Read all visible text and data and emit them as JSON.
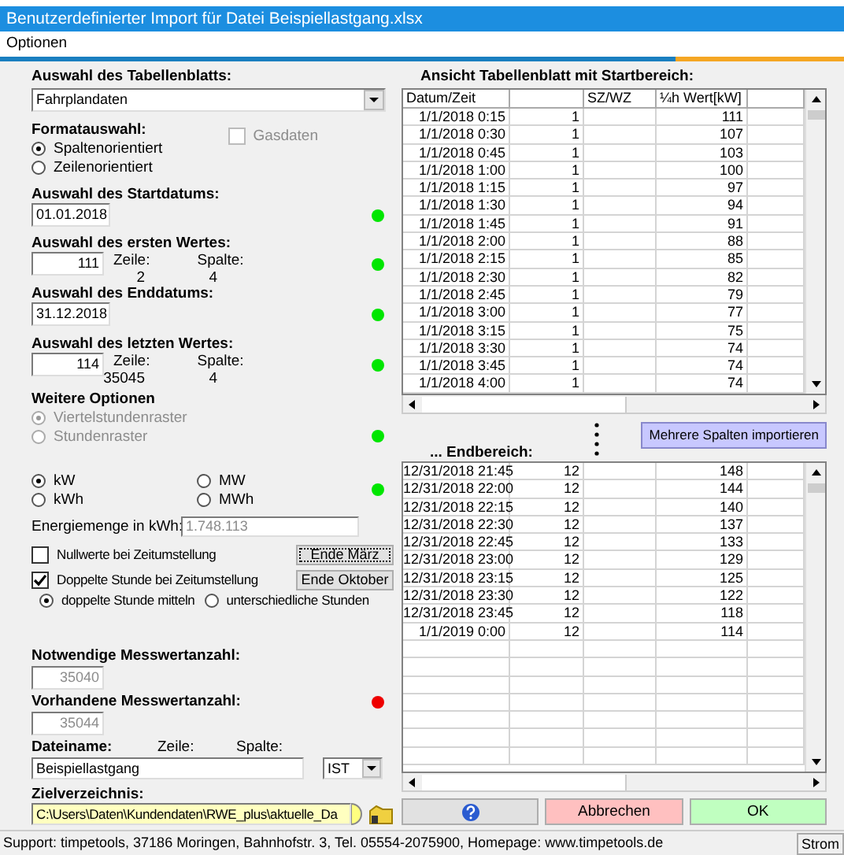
{
  "window": {
    "title": "Benutzerdefinierter Import für Datei Beispiellastgang.xlsx"
  },
  "menu": [
    "Optionen"
  ],
  "sheet": {
    "label": "Auswahl des Tabellenblatts:",
    "value": "Fahrplandaten"
  },
  "format": {
    "label": "Formatauswahl:",
    "options": [
      {
        "label": "Spaltenorientiert",
        "selected": true
      },
      {
        "label": "Zeilenorientiert",
        "selected": false
      }
    ],
    "gas": {
      "label": "Gasdaten",
      "checked": false,
      "disabled": true
    }
  },
  "start_date": {
    "label": "Auswahl des Startdatums:",
    "value": "01.01.2018",
    "indicator": {
      "color": "#00e600"
    }
  },
  "first_value": {
    "label": "Auswahl des ersten Wertes:",
    "value": "111",
    "row_label": "Zeile:",
    "col_label": "Spalte:",
    "row": "2",
    "col": "4",
    "indicator": {
      "color": "#00e600"
    }
  },
  "end_date": {
    "label": "Auswahl des Enddatums:",
    "value": "31.12.2018",
    "indicator": {
      "color": "#00e600"
    }
  },
  "last_value": {
    "label": "Auswahl des letzten Wertes:",
    "value": "114",
    "row_label": "Zeile:",
    "col_label": "Spalte:",
    "row": "35045",
    "col": "4",
    "indicator": {
      "color": "#00e600"
    }
  },
  "further": {
    "label": "Weitere Optionen",
    "options": [
      {
        "label": "Viertelstundenraster",
        "selected": true,
        "disabled": true
      },
      {
        "label": "Stundenraster",
        "selected": false,
        "disabled": true
      }
    ],
    "indicator": {
      "color": "#00e600"
    }
  },
  "units": {
    "options": [
      {
        "label": "kW",
        "selected": true
      },
      {
        "label": "MW",
        "selected": false
      },
      {
        "label": "kWh",
        "selected": false
      },
      {
        "label": "MWh",
        "selected": false
      }
    ],
    "indicator": {
      "color": "#00e600"
    }
  },
  "energy": {
    "label": "Energiemenge in kWh:",
    "value": "1.748.113",
    "disabled": true
  },
  "dst": [
    {
      "label": "Nullwerte bei Zeitumstellung",
      "checked": false,
      "button": "Ende März",
      "focused": true
    },
    {
      "label": "Doppelte Stunde bei Zeitumstellung",
      "checked": true,
      "button": "Ende Oktober",
      "focused": false
    }
  ],
  "double_hour": [
    {
      "label": "doppelte Stunde mitteln",
      "selected": true
    },
    {
      "label": "unterschiedliche Stunden",
      "selected": false
    }
  ],
  "required": {
    "label": "Notwendige Messwertanzahl:",
    "value": "35040",
    "disabled": true
  },
  "present": {
    "label": "Vorhandene Messwertanzahl:",
    "value": "35044",
    "disabled": true,
    "indicator": {
      "color": "#ee0000"
    }
  },
  "file": {
    "label": "Dateiname:",
    "row_label": "Zeile:",
    "col_label": "Spalte:",
    "value": "Beispiellastgang",
    "type": "IST"
  },
  "target": {
    "label": "Zielverzeichnis:",
    "value": "C:\\Users\\Daten\\Kundendaten\\RWE_plus\\aktuelle_Da"
  },
  "preview": {
    "title": "Ansicht Tabellenblatt mit Startbereich:",
    "columns": {
      "datum_zeit": "Datum/Zeit",
      "sz_wz": "SZ/WZ",
      "wert": "¼h Wert[kW]"
    },
    "rows": [
      {
        "datum_zeit": "1/1/2018 0:15",
        "column_2": "1",
        "wert": "111"
      },
      {
        "datum_zeit": "1/1/2018 0:30",
        "column_2": "1",
        "wert": "107"
      },
      {
        "datum_zeit": "1/1/2018 0:45",
        "column_2": "1",
        "wert": "103"
      },
      {
        "datum_zeit": "1/1/2018 1:00",
        "column_2": "1",
        "wert": "100"
      },
      {
        "datum_zeit": "1/1/2018 1:15",
        "column_2": "1",
        "wert": "97"
      },
      {
        "datum_zeit": "1/1/2018 1:30",
        "column_2": "1",
        "wert": "94"
      },
      {
        "datum_zeit": "1/1/2018 1:45",
        "column_2": "1",
        "wert": "91"
      },
      {
        "datum_zeit": "1/1/2018 2:00",
        "column_2": "1",
        "wert": "88"
      },
      {
        "datum_zeit": "1/1/2018 2:15",
        "column_2": "1",
        "wert": "85"
      },
      {
        "datum_zeit": "1/1/2018 2:30",
        "column_2": "1",
        "wert": "82"
      },
      {
        "datum_zeit": "1/1/2018 2:45",
        "column_2": "1",
        "wert": "79"
      },
      {
        "datum_zeit": "1/1/2018 3:00",
        "column_2": "1",
        "wert": "77"
      },
      {
        "datum_zeit": "1/1/2018 3:15",
        "column_2": "1",
        "wert": "75"
      },
      {
        "datum_zeit": "1/1/2018 3:30",
        "column_2": "1",
        "wert": "74"
      },
      {
        "datum_zeit": "1/1/2018 3:45",
        "column_2": "1",
        "wert": "74"
      },
      {
        "datum_zeit": "1/1/2018 4:00",
        "column_2": "1",
        "wert": "74"
      }
    ]
  },
  "more_button": "Mehrere Spalten importieren",
  "end_preview": {
    "title": "... Endbereich:",
    "rows": [
      {
        "datum_zeit": "12/31/2018 21:45",
        "column_2": "12",
        "wert": "148"
      },
      {
        "datum_zeit": "12/31/2018 22:00",
        "column_2": "12",
        "wert": "144"
      },
      {
        "datum_zeit": "12/31/2018 22:15",
        "column_2": "12",
        "wert": "140"
      },
      {
        "datum_zeit": "12/31/2018 22:30",
        "column_2": "12",
        "wert": "137"
      },
      {
        "datum_zeit": "12/31/2018 22:45",
        "column_2": "12",
        "wert": "133"
      },
      {
        "datum_zeit": "12/31/2018 23:00",
        "column_2": "12",
        "wert": "129"
      },
      {
        "datum_zeit": "12/31/2018 23:15",
        "column_2": "12",
        "wert": "125"
      },
      {
        "datum_zeit": "12/31/2018 23:30",
        "column_2": "12",
        "wert": "122"
      },
      {
        "datum_zeit": "12/31/2018 23:45",
        "column_2": "12",
        "wert": "118"
      },
      {
        "datum_zeit": "1/1/2019 0:00",
        "column_2": "12",
        "wert": "114"
      }
    ]
  },
  "buttons": [
    {
      "kind": "help"
    },
    {
      "kind": "cancel",
      "label": "Abbrechen"
    },
    {
      "kind": "ok",
      "label": "OK"
    }
  ],
  "status_bar": {
    "text": "Support: timpetools, 37186 Moringen, Bahnhofstr. 3, Tel. 05554-2075900, Homepage: www.timpetools.de",
    "mode": "Strom"
  }
}
